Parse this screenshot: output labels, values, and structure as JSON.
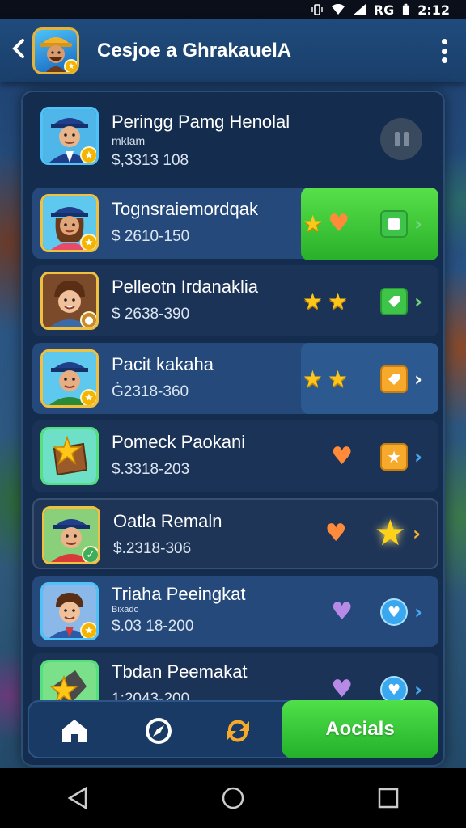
{
  "status_bar": {
    "time": "2:12",
    "network": "RG"
  },
  "header": {
    "title": "Cesjoe a GhrakauelA"
  },
  "players": [
    {
      "name": "Peringg Pamg Henolal",
      "subtitle": "mklam",
      "price": "$,3313 108"
    },
    {
      "name": "Tognsraiemordqak",
      "price": "$ 2610-150"
    },
    {
      "name": "Pelleotn Irdanaklia",
      "price": "$ 2638-390"
    },
    {
      "name": "Pacit kakaha",
      "price": "Ġ2318-360"
    },
    {
      "name": "Pomeck Paokani",
      "price": "$.3318-203"
    },
    {
      "name": "Oatla Remaln",
      "price": "$.2318-306"
    },
    {
      "name": "Triaha Peeingkat",
      "subtitle": "Bixado",
      "price": "$.03 18-200"
    },
    {
      "name": "Tbdan Peemakat",
      "price": "1:2043-200"
    }
  ],
  "bottom_nav": {
    "cta_label": "Aocials"
  },
  "colors": {
    "accent_green": "#3fc44a",
    "panel": "#142c4d",
    "row": "#24497a",
    "gold": "#ffc61a"
  },
  "icons": {
    "back": "chevron-left-icon",
    "more": "more-vertical-icon",
    "pause": "pause-icon",
    "star": "star-icon",
    "heart": "heart-icon",
    "home": "home-icon",
    "compass": "compass-icon",
    "refresh": "refresh-icon"
  }
}
